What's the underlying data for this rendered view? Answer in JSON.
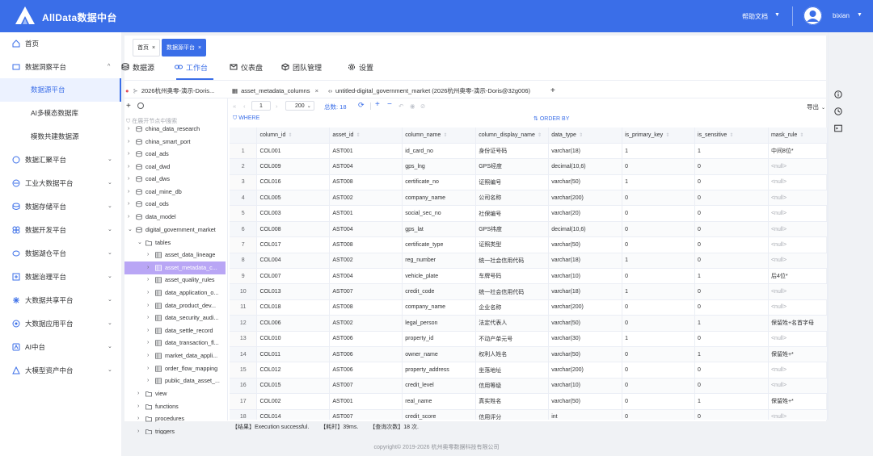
{
  "app": {
    "title": "AllData数据中台",
    "help": "帮助文档",
    "user": "bixian",
    "accent": "#3a6ee8"
  },
  "sidebar": {
    "items": [
      {
        "label": "首页",
        "icon": "home-icon"
      },
      {
        "label": "数据洞察平台",
        "icon": "insight-icon",
        "expanded": true
      },
      {
        "label": "数据汇聚平台",
        "icon": "converge-icon"
      },
      {
        "label": "工业大数据平台",
        "icon": "industry-icon"
      },
      {
        "label": "数据存储平台",
        "icon": "storage-icon"
      },
      {
        "label": "数据开发平台",
        "icon": "dev-icon"
      },
      {
        "label": "数据湖仓平台",
        "icon": "lakehouse-icon"
      },
      {
        "label": "数据治理平台",
        "icon": "governance-icon"
      },
      {
        "label": "大数据共享平台",
        "icon": "share-icon"
      },
      {
        "label": "大数据应用平台",
        "icon": "app-icon"
      },
      {
        "label": "AI中台",
        "icon": "ai-icon"
      },
      {
        "label": "大模型资产中台",
        "icon": "model-icon"
      }
    ],
    "sub_items": [
      "数据源平台",
      "AI多模态数据库",
      "模数共建数据源"
    ]
  },
  "page_tabs": [
    {
      "label": "首页"
    },
    {
      "label": "数据源平台"
    }
  ],
  "main_tabs": [
    "数据源",
    "工作台",
    "仪表盘",
    "团队管理",
    "设置"
  ],
  "editor_tabs": {
    "connection": "2026杭州奥零-演示-Doris...",
    "table": "asset_metadata_columns",
    "query": "untitled-digital_government_market (2026杭州奥零-演示-Doris@32g006)",
    "add": "+"
  },
  "tree": {
    "search_placeholder": "在展开节点中搜索",
    "nodes": [
      {
        "label": "china_data_research"
      },
      {
        "label": "china_smart_port"
      },
      {
        "label": "coal_ads"
      },
      {
        "label": "coal_dwd"
      },
      {
        "label": "coal_dws"
      },
      {
        "label": "coal_mine_db"
      },
      {
        "label": "coal_ods"
      },
      {
        "label": "data_model"
      },
      {
        "label": "digital_government_market"
      },
      {
        "label": "tables"
      },
      {
        "label": "asset_data_lineage"
      },
      {
        "label": "asset_metadata_c..."
      },
      {
        "label": "asset_quality_rules"
      },
      {
        "label": "data_application_o..."
      },
      {
        "label": "data_product_dev..."
      },
      {
        "label": "data_security_audi..."
      },
      {
        "label": "data_settle_record"
      },
      {
        "label": "data_transaction_fl..."
      },
      {
        "label": "market_data_appli..."
      },
      {
        "label": "order_flow_mapping"
      },
      {
        "label": "public_data_asset_..."
      },
      {
        "label": "view"
      },
      {
        "label": "functions"
      },
      {
        "label": "procedures"
      },
      {
        "label": "triggers"
      }
    ]
  },
  "toolbar": {
    "page": "1",
    "page_size": "200",
    "total": "总数: 18",
    "export": "导出"
  },
  "filter": {
    "where": "WHERE",
    "order_by": "ORDER BY"
  },
  "table": {
    "columns": [
      "column_id",
      "asset_id",
      "column_name",
      "column_display_name",
      "data_type",
      "is_primary_key",
      "is_sensitive",
      "mask_rule"
    ],
    "rows": [
      [
        "1",
        "COL001",
        "AST001",
        "id_card_no",
        "身份证号码",
        "varchar(18)",
        "1",
        "1",
        "中间8位*"
      ],
      [
        "2",
        "COL009",
        "AST004",
        "gps_lng",
        "GPS经度",
        "decimal(10,6)",
        "0",
        "0",
        "<null>"
      ],
      [
        "3",
        "COL016",
        "AST008",
        "certificate_no",
        "证照编号",
        "varchar(50)",
        "1",
        "0",
        "<null>"
      ],
      [
        "4",
        "COL005",
        "AST002",
        "company_name",
        "公司名称",
        "varchar(200)",
        "0",
        "0",
        "<null>"
      ],
      [
        "5",
        "COL003",
        "AST001",
        "social_sec_no",
        "社保编号",
        "varchar(20)",
        "0",
        "0",
        "<null>"
      ],
      [
        "6",
        "COL008",
        "AST004",
        "gps_lat",
        "GPS纬度",
        "decimal(10,6)",
        "0",
        "0",
        "<null>"
      ],
      [
        "7",
        "COL017",
        "AST008",
        "certificate_type",
        "证照类型",
        "varchar(50)",
        "0",
        "0",
        "<null>"
      ],
      [
        "8",
        "COL004",
        "AST002",
        "reg_number",
        "统一社会信用代码",
        "varchar(18)",
        "1",
        "0",
        "<null>"
      ],
      [
        "9",
        "COL007",
        "AST004",
        "vehicle_plate",
        "车牌号码",
        "varchar(10)",
        "0",
        "1",
        "后4位*"
      ],
      [
        "10",
        "COL013",
        "AST007",
        "credit_code",
        "统一社会信用代码",
        "varchar(18)",
        "1",
        "0",
        "<null>"
      ],
      [
        "11",
        "COL018",
        "AST008",
        "company_name",
        "企业名称",
        "varchar(200)",
        "0",
        "0",
        "<null>"
      ],
      [
        "12",
        "COL006",
        "AST002",
        "legal_person",
        "法定代表人",
        "varchar(50)",
        "0",
        "1",
        "保留姓+名首字母"
      ],
      [
        "13",
        "COL010",
        "AST006",
        "property_id",
        "不动产单元号",
        "varchar(30)",
        "1",
        "0",
        "<null>"
      ],
      [
        "14",
        "COL011",
        "AST006",
        "owner_name",
        "权利人姓名",
        "varchar(50)",
        "0",
        "1",
        "保留姓+*"
      ],
      [
        "15",
        "COL012",
        "AST006",
        "property_address",
        "坐落地址",
        "varchar(200)",
        "0",
        "0",
        "<null>"
      ],
      [
        "16",
        "COL015",
        "AST007",
        "credit_level",
        "信用等级",
        "varchar(10)",
        "0",
        "0",
        "<null>"
      ],
      [
        "17",
        "COL002",
        "AST001",
        "real_name",
        "真实姓名",
        "varchar(50)",
        "0",
        "1",
        "保留姓+*"
      ],
      [
        "18",
        "COL014",
        "AST007",
        "credit_score",
        "信用评分",
        "int",
        "0",
        "0",
        "<null>"
      ]
    ]
  },
  "status": {
    "result": "【结果】Execution successful.",
    "time": "【耗时】39ms.",
    "count": "【查询次数】18 次."
  },
  "footer": "copyright© 2019-2026 杭州奥零数据科技有限公司"
}
